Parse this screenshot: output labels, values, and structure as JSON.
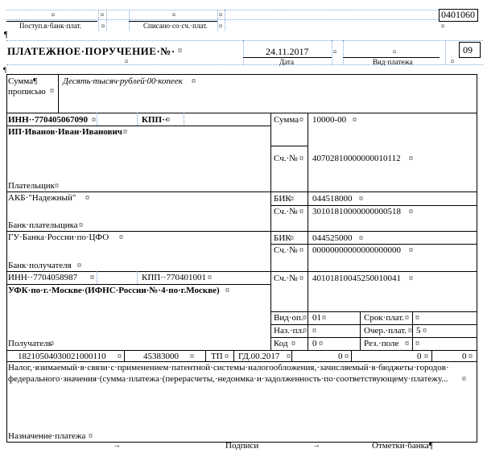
{
  "header": {
    "form_code": "0401060",
    "bank_received_label": "Поступ.в·банк·плат.",
    "debited_label": "Списано·со·сч.·плат.",
    "title": "ПЛАТЕЖНОЕ·ПОРУЧЕНИЕ·№·",
    "date_value": "24.11.2017",
    "date_label": "Дата",
    "payment_type_label": "Вид·платежа",
    "status_value": "09"
  },
  "amount_words": {
    "label_line1": "Сумма¶",
    "label_line2": "прописью",
    "value": "Десять·тысяч·рублей·00·копеек"
  },
  "payer": {
    "inn": "ИНН··770405067090",
    "kpp": "КПП··",
    "name": "ИП·Иванов·Иван·Иванович",
    "label": "Плательщик",
    "sum_label": "Сумма",
    "sum_value": "10000-00",
    "account_label": "Сч.·№",
    "account_value": "40702810000000010112"
  },
  "payer_bank": {
    "name": "АКБ·\"Надежный\"",
    "label": "Банк·плательщика",
    "bik_label": "БИК",
    "bik_value": "044518000",
    "account_label": "Сч.·№",
    "account_value": "30101810000000000518"
  },
  "payee_bank": {
    "name": "ГУ·Банка·России·по·ЦФО",
    "label": "Банк·получателя",
    "bik_label": "БИК",
    "bik_value": "044525000",
    "account_label": "Сч.·№",
    "account_value": "00000000000000000000"
  },
  "payee": {
    "inn": "ИНН··7704058987",
    "kpp": "КПП··770401001",
    "name": "УФК·по·г.·Москве·(ИФНС·России·№·4·по·г.Москве)",
    "label": "Получатель",
    "account_label": "Сч.·№",
    "account_value": "40101810045250010041"
  },
  "operation": {
    "vid_op_label": "Вид·оп.",
    "vid_op_value": "01",
    "srok_label": "Срок·плат.",
    "naz_label": "Наз.·пл.",
    "ocher_label": "Очер.·плат.",
    "ocher_value": "5",
    "kod_label": "Код",
    "kod_value": "0",
    "rez_label": "Рез.·поле"
  },
  "tax_fields": {
    "kbk": "18210504030021000110",
    "oktmo": "45383000",
    "basis": "ТП",
    "period": "ГД.00.2017",
    "doc_number": "0",
    "doc_date": "0",
    "extra": "0"
  },
  "purpose": {
    "text_line1": "Налог,·взимаемый·в·связи·с·применением·патентной·системы·налогообложения,·зачисляемый·в·бюджеты·городов·",
    "text_line2": "федерального·значения·(сумма·платежа·(перерасчеты,·недоимка·и·задолженность·по·соответствующему·платежу...",
    "label": "Назначение·платежа"
  },
  "footer": {
    "signatures": "Подписи",
    "bank_marks": "Отметки·банка¶",
    "arrow": "→"
  }
}
